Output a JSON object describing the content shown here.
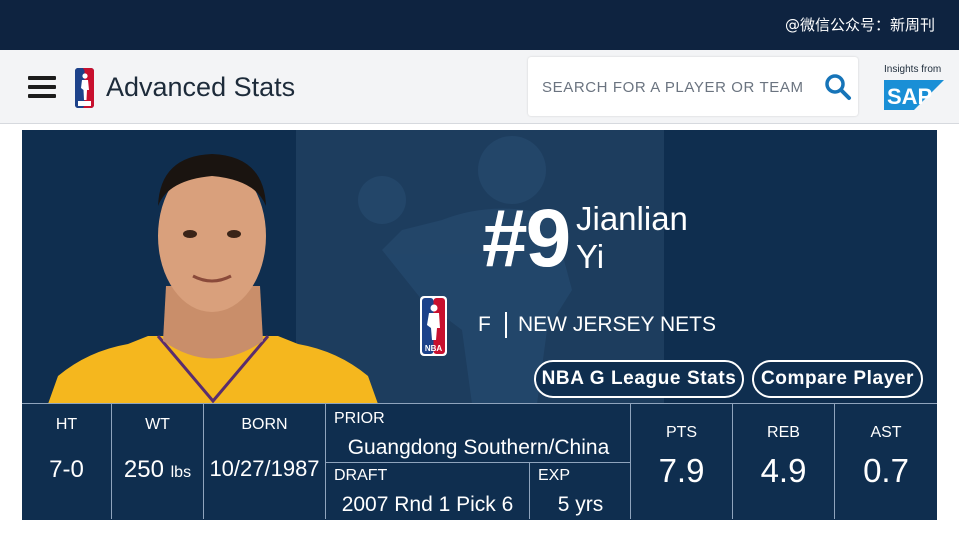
{
  "watermark": "@微信公众号：新周刊",
  "header": {
    "title": "Advanced Stats",
    "search_placeholder": "SEARCH FOR A PLAYER OR TEAM",
    "sponsor_caption": "Insights from",
    "sponsor_logo_text": "SAP"
  },
  "player": {
    "number": "#9",
    "first_name": "Jianlian",
    "last_name": "Yi",
    "position": "F",
    "team": "NEW JERSEY NETS",
    "league_logo_text": "NBA"
  },
  "buttons": {
    "gleague": "NBA G League Stats",
    "compare": "Compare Player"
  },
  "bio": {
    "ht_label": "HT",
    "ht_value": "7-0",
    "wt_label": "WT",
    "wt_value": "250",
    "wt_unit": "lbs",
    "born_label": "BORN",
    "born_value": "10/27/1987",
    "prior_label": "PRIOR",
    "prior_value": "Guangdong Southern/China",
    "draft_label": "DRAFT",
    "draft_value": "2007 Rnd 1 Pick 6",
    "exp_label": "EXP",
    "exp_value": "5 yrs"
  },
  "stats": {
    "pts_label": "PTS",
    "pts_value": "7.9",
    "reb_label": "REB",
    "reb_value": "4.9",
    "ast_label": "AST",
    "ast_value": "0.7"
  },
  "colors": {
    "topbar": "#0e2340",
    "card": "#0f2e4f",
    "nba_blue": "#1d428a",
    "nba_red": "#c8102e",
    "sap_blue": "#1a8fd6",
    "jersey_gold": "#f5b71e"
  }
}
